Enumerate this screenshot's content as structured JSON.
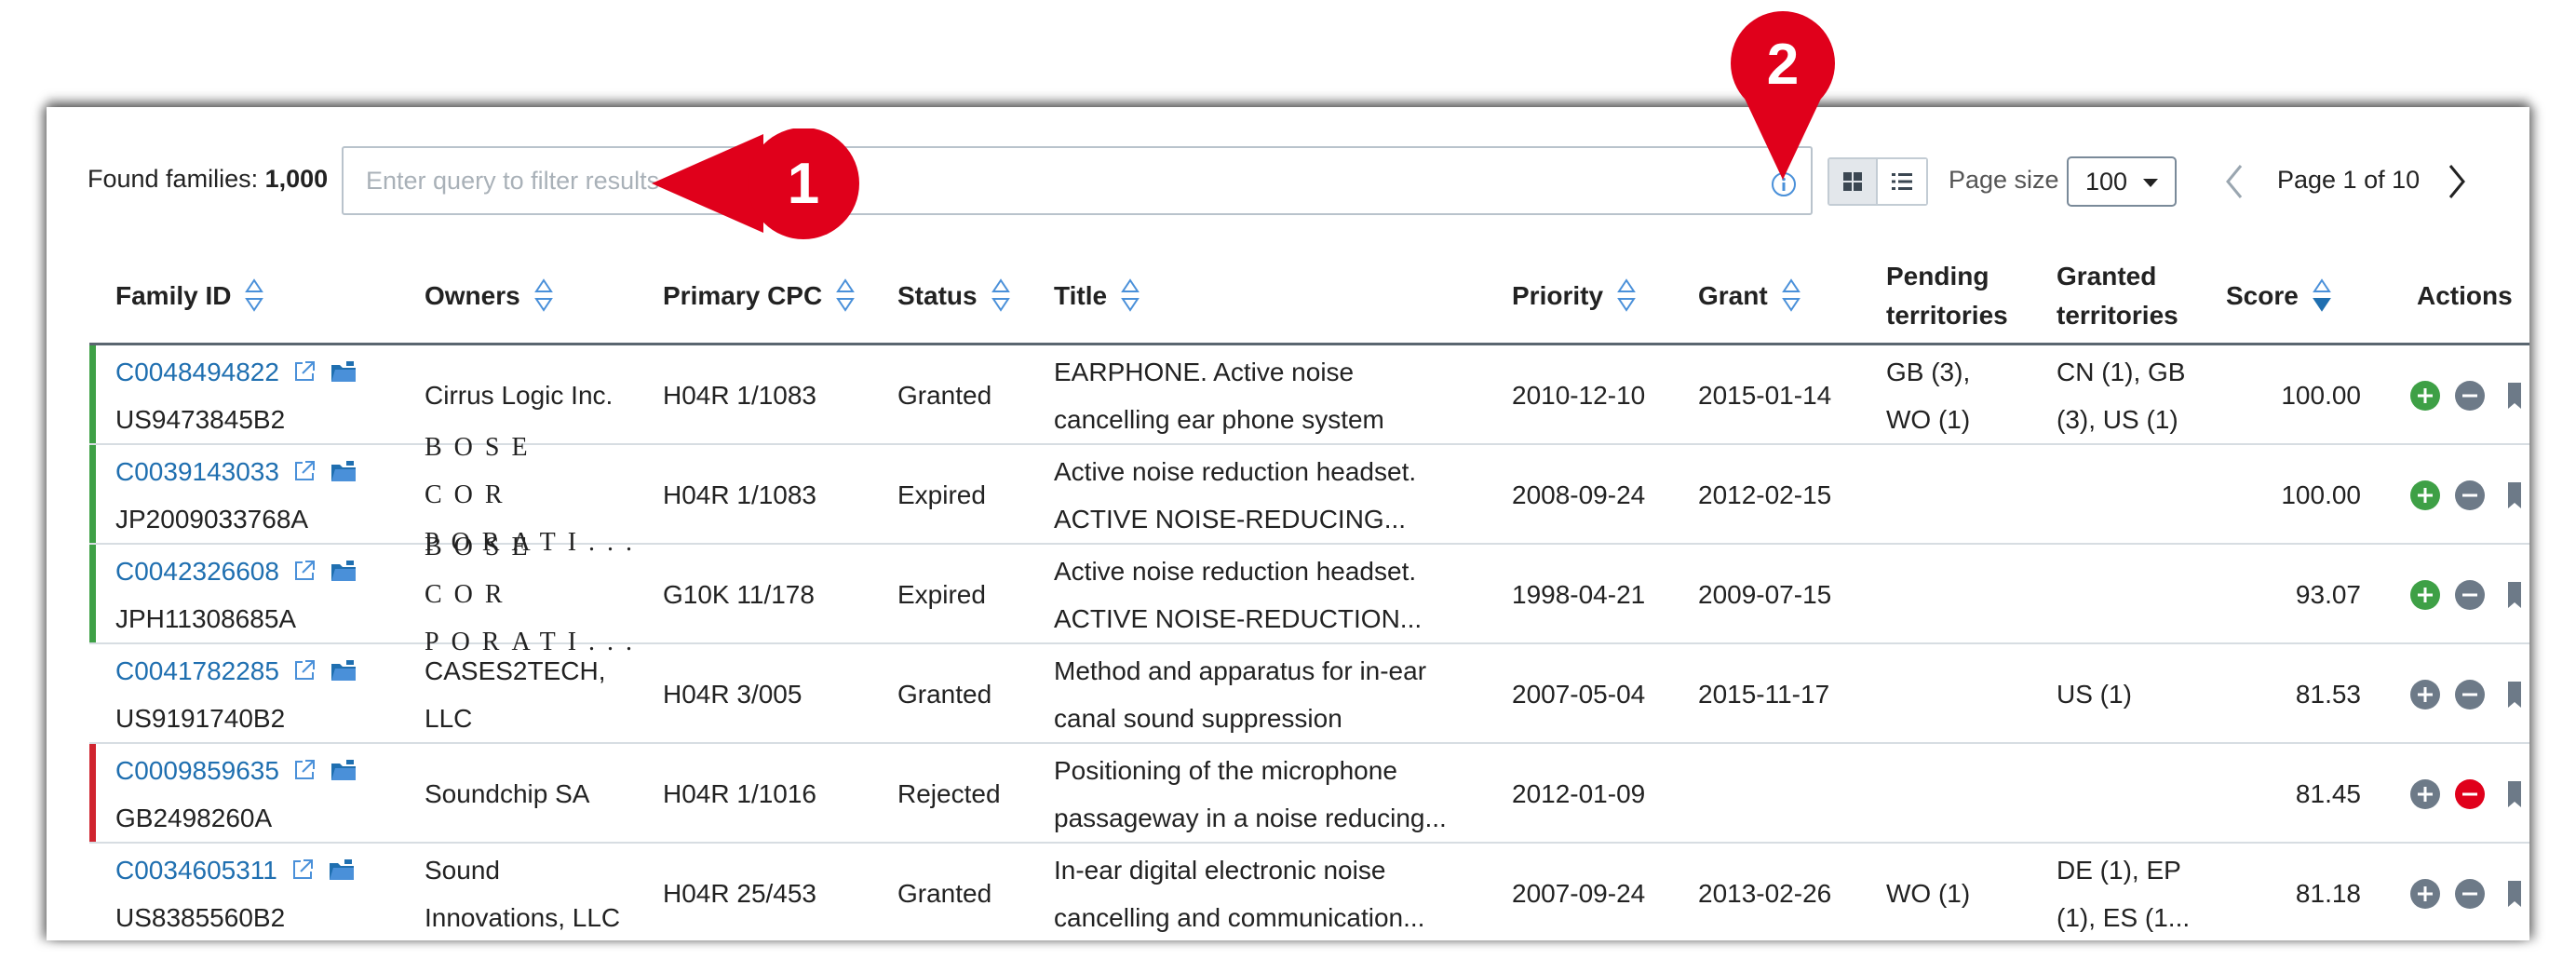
{
  "toolbar": {
    "found_label": "Found families:",
    "found_count": "1,000",
    "search_placeholder": "Enter query to filter results",
    "page_size_label": "Page size",
    "page_size_value": "100",
    "page_label": "Page 1 of 10"
  },
  "columns": [
    {
      "label": "Family ID",
      "sortable": true
    },
    {
      "label": "Owners",
      "sortable": true
    },
    {
      "label": "Primary CPC",
      "sortable": true
    },
    {
      "label": "Status",
      "sortable": true
    },
    {
      "label": "Title",
      "sortable": true
    },
    {
      "label": "Priority",
      "sortable": true
    },
    {
      "label": "Grant",
      "sortable": true
    },
    {
      "label_1": "Pending",
      "label_2": "territories",
      "sortable": false
    },
    {
      "label_1": "Granted",
      "label_2": "territories",
      "sortable": false
    },
    {
      "label": "Score",
      "sortable": true,
      "sorted": "desc"
    },
    {
      "label": "Actions",
      "sortable": false
    }
  ],
  "rows": [
    {
      "family_id": "C0048494822",
      "patent": "US9473845B2",
      "owner_1": "Cirrus Logic Inc.",
      "owner_2": "",
      "cpc": "H04R 1/1083",
      "status": "Granted",
      "title_1": "EARPHONE. Active noise",
      "title_2": "cancelling ear phone system",
      "priority": "2010-12-10",
      "grant": "2015-01-14",
      "pending_1": "GB (3),",
      "pending_2": "WO (1)",
      "granted_1": "CN (1), GB",
      "granted_2": "(3), US (1)",
      "score": "100.00",
      "marker": "#3ea046",
      "add_color": "#3ea046",
      "remove_color": "#6d7a88"
    },
    {
      "family_id": "C0039143033",
      "patent": "JP2009033768A",
      "owner_1": "BOSE COR",
      "owner_2": "PORATI...",
      "cpc": "H04R 1/1083",
      "status": "Expired",
      "title_1": "Active noise reduction headset.",
      "title_2": "ACTIVE NOISE-REDUCING...",
      "priority": "2008-09-24",
      "grant": "2012-02-15",
      "pending_1": "",
      "pending_2": "",
      "granted_1": "",
      "granted_2": "",
      "score": "100.00",
      "marker": "#3ea046",
      "add_color": "#3ea046",
      "remove_color": "#6d7a88"
    },
    {
      "family_id": "C0042326608",
      "patent": "JPH11308685A",
      "owner_1": "BOSE COR",
      "owner_2": "PORATI...",
      "cpc": "G10K 11/178",
      "status": "Expired",
      "title_1": "Active noise reduction headset.",
      "title_2": "ACTIVE NOISE-REDUCTION...",
      "priority": "1998-04-21",
      "grant": "2009-07-15",
      "pending_1": "",
      "pending_2": "",
      "granted_1": "",
      "granted_2": "",
      "score": "93.07",
      "marker": "#3ea046",
      "add_color": "#3ea046",
      "remove_color": "#6d7a88"
    },
    {
      "family_id": "C0041782285",
      "patent": "US9191740B2",
      "owner_1": "CASES2TECH,",
      "owner_2": "LLC",
      "cpc": "H04R 3/005",
      "status": "Granted",
      "title_1": "Method and apparatus for in-ear",
      "title_2": "canal sound suppression",
      "priority": "2007-05-04",
      "grant": "2015-11-17",
      "pending_1": "",
      "pending_2": "",
      "granted_1": "US (1)",
      "granted_2": "",
      "score": "81.53",
      "marker": "",
      "add_color": "#6d7a88",
      "remove_color": "#6d7a88"
    },
    {
      "family_id": "C0009859635",
      "patent": "GB2498260A",
      "owner_1": "Soundchip SA",
      "owner_2": "",
      "cpc": "H04R 1/1016",
      "status": "Rejected",
      "title_1": "Positioning of the microphone",
      "title_2": "passageway in a noise reducing...",
      "priority": "2012-01-09",
      "grant": "",
      "pending_1": "",
      "pending_2": "",
      "granted_1": "",
      "granted_2": "",
      "score": "81.45",
      "marker": "#d0242f",
      "add_color": "#6d7a88",
      "remove_color": "#e0001b"
    },
    {
      "family_id": "C0034605311",
      "patent": "US8385560B2",
      "owner_1": "Sound",
      "owner_2": "Innovations, LLC",
      "cpc": "H04R 25/453",
      "status": "Granted",
      "title_1": "In-ear digital electronic noise",
      "title_2": "cancelling and communication...",
      "priority": "2007-09-24",
      "grant": "2013-02-26",
      "pending_1": "WO (1)",
      "pending_2": "",
      "granted_1": "DE (1), EP",
      "granted_2": "(1), ES (1...",
      "score": "81.18",
      "marker": "",
      "add_color": "#6d7a88",
      "remove_color": "#6d7a88"
    }
  ],
  "callouts": [
    {
      "number": "1",
      "color": "#e0001b"
    },
    {
      "number": "2",
      "color": "#e0001b"
    }
  ],
  "colors": {
    "link": "#1f6fb0",
    "sort_icon": "#4a90d9",
    "granted_marker": "#3ea046",
    "rejected_marker": "#d0242f"
  }
}
